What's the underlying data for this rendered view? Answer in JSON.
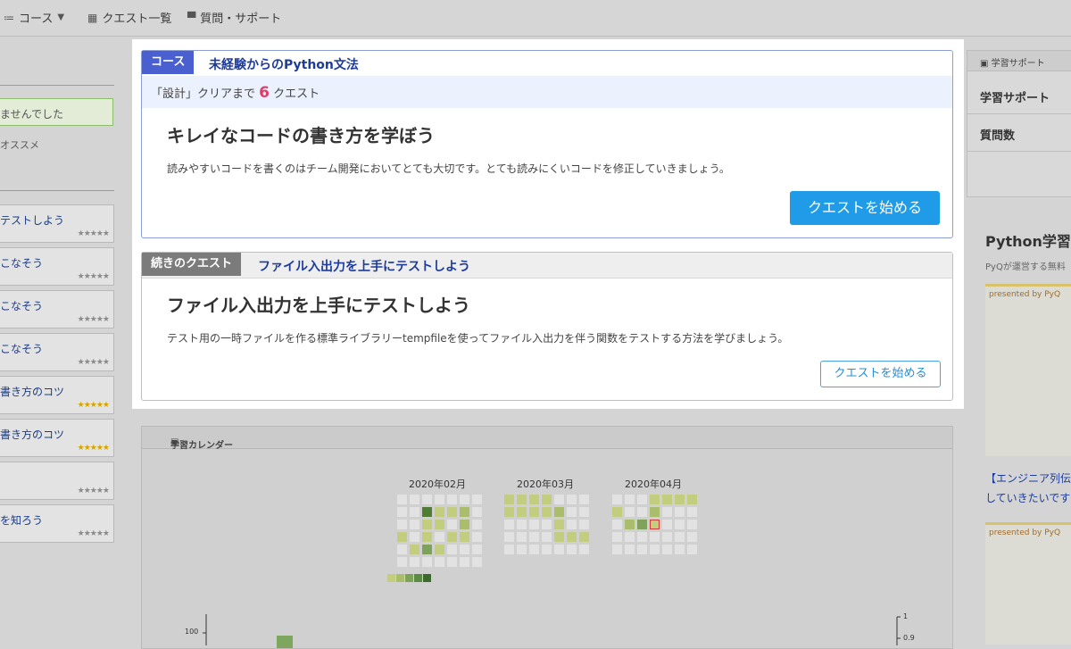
{
  "nav": {
    "course_label": "コース",
    "quests_label": "クエスト一覧",
    "support_label": "質問・サポート"
  },
  "left": {
    "notice": "ませんでした",
    "recommend": "オススメ",
    "quests": [
      {
        "title": "テストしよう",
        "stars": "★★★★★",
        "gold": false
      },
      {
        "title": "こなそう",
        "stars": "★★★★★",
        "gold": false
      },
      {
        "title": "こなそう",
        "stars": "★★★★★",
        "gold": false
      },
      {
        "title": "こなそう",
        "stars": "★★★★★",
        "gold": false
      },
      {
        "title": "書き方のコツ",
        "stars": "★★★★★",
        "gold": true
      },
      {
        "title": "書き方のコツ",
        "stars": "★★★★★",
        "gold": true
      },
      {
        "title": "",
        "stars": "★★★★★",
        "gold": false
      },
      {
        "title": "を知ろう",
        "stars": "★★★★★",
        "gold": false
      }
    ]
  },
  "course_card": {
    "badge": "コース",
    "course_name": "未経験からのPython文法",
    "progress_prefix": "「設計」クリアまで",
    "progress_count": "6",
    "progress_suffix": "クエスト",
    "title": "キレイなコードの書き方を学ぼう",
    "description": "読みやすいコードを書くのはチーム開発においてとても大切です。とても読みにくいコードを修正していきましょう。",
    "button": "クエストを始める"
  },
  "continue_card": {
    "badge": "続きのクエスト",
    "quest_link": "ファイル入出力を上手にテストしよう",
    "title": "ファイル入出力を上手にテストしよう",
    "description": "テスト用の一時ファイルを作る標準ライブラリーtempfileを使ってファイル入出力を伴う関数をテストする方法を学びましょう。",
    "button": "クエストを始める"
  },
  "calendar": {
    "title": "学習カレンダー",
    "months": [
      "2020年02月",
      "2020年03月",
      "2020年04月"
    ],
    "legend_colors": [
      "#c3cd7e",
      "#a9bd6a",
      "#7ea25a",
      "#5b8a42",
      "#3d6a2c"
    ],
    "axis_left_label": "100",
    "axis_right_labels": [
      "1",
      "0.9"
    ]
  },
  "right": {
    "panel_title": "学習サポート",
    "row1": "学習サポート",
    "row2": "質問数",
    "promo_title": "Python学習",
    "promo_sub": "PyQが運営する無料",
    "presented": "presented by PyQ",
    "link1": "【エンジニア列伝",
    "link2": "していきたいです"
  },
  "colors": {
    "accent_blue": "#1f9be8",
    "badge_blue": "#4a5fd0",
    "link_blue": "#1d3c9a",
    "count_pink": "#e03c67"
  }
}
